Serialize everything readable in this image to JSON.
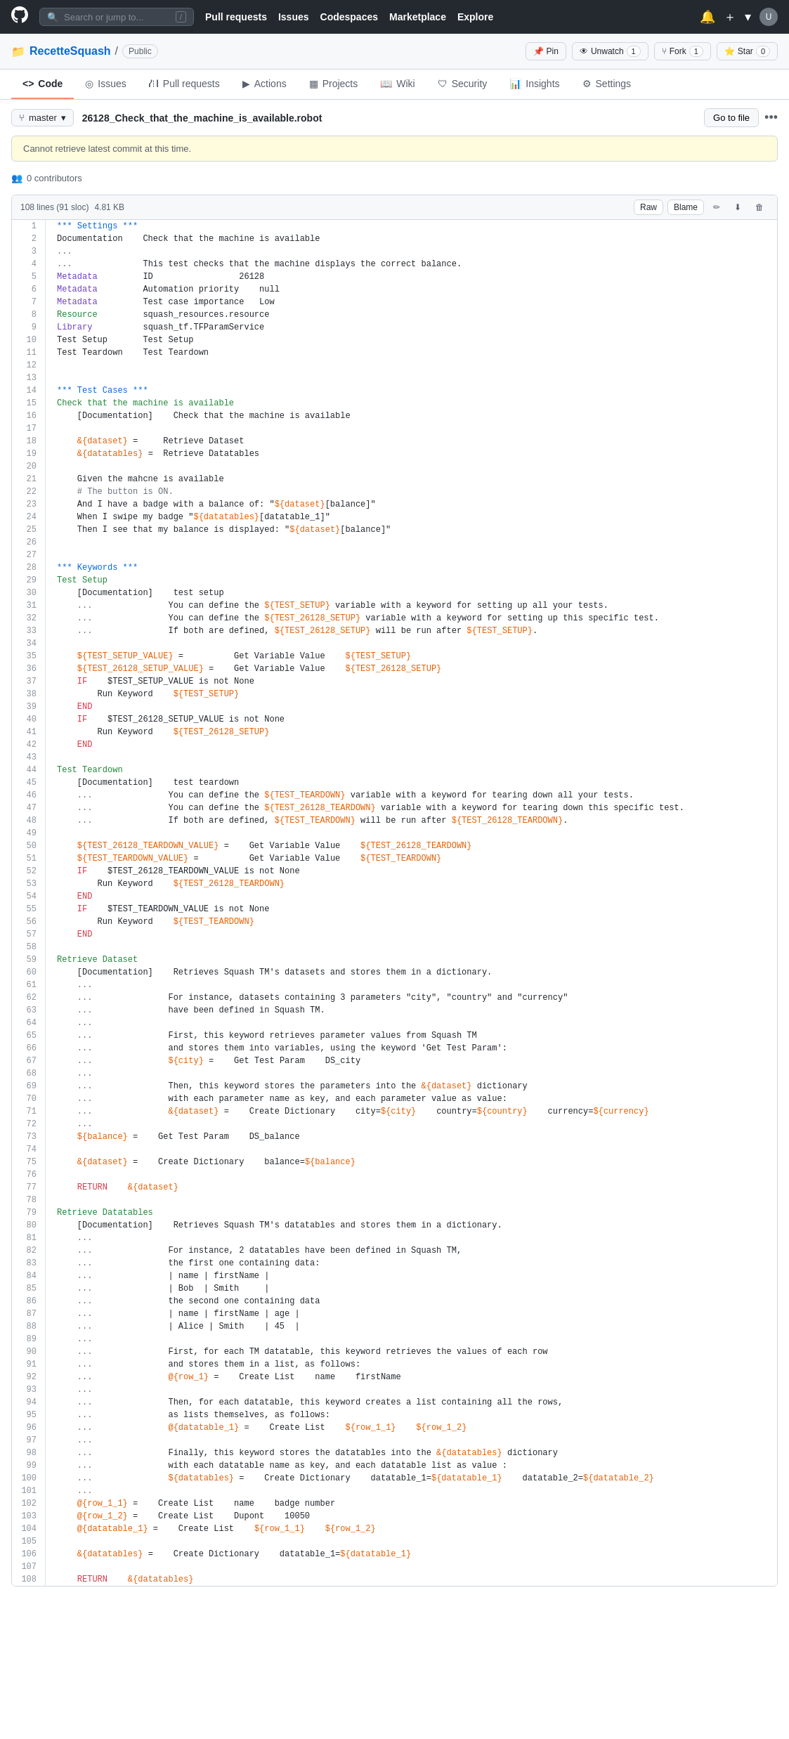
{
  "topnav": {
    "search_placeholder": "Search or jump to...",
    "slash_key": "/",
    "links": [
      "Pull requests",
      "Issues",
      "Codespaces",
      "Marketplace",
      "Explore"
    ]
  },
  "repo": {
    "owner": "RecetteSquash",
    "separator": "/",
    "visibility": "Public",
    "pin_label": "Pin",
    "unwatch_label": "Unwatch",
    "unwatch_count": "1",
    "fork_label": "Fork",
    "fork_count": "1",
    "star_label": "Star",
    "star_count": "0"
  },
  "tabs": [
    {
      "label": "Code",
      "icon": "code-icon",
      "active": true
    },
    {
      "label": "Issues",
      "icon": "issue-icon",
      "active": false
    },
    {
      "label": "Pull requests",
      "icon": "pr-icon",
      "active": false
    },
    {
      "label": "Actions",
      "icon": "action-icon",
      "active": false
    },
    {
      "label": "Projects",
      "icon": "project-icon",
      "active": false
    },
    {
      "label": "Wiki",
      "icon": "wiki-icon",
      "active": false
    },
    {
      "label": "Security",
      "icon": "security-icon",
      "active": false
    },
    {
      "label": "Insights",
      "icon": "insights-icon",
      "active": false
    },
    {
      "label": "Settings",
      "icon": "settings-icon",
      "active": false
    }
  ],
  "filenav": {
    "branch": "master",
    "file_name": "26128_Check_that_the_machine_is_available.robot",
    "go_to_file": "Go to file"
  },
  "code_info": {
    "lines": "108 lines (91 sloc)",
    "size": "4.81 KB",
    "raw_label": "Raw",
    "blame_label": "Blame"
  },
  "commit_warning": "Cannot retrieve latest commit at this time.",
  "contributors": "0 contributors",
  "code_lines": [
    {
      "n": 1,
      "t": "*** Settings ***"
    },
    {
      "n": 2,
      "t": "Documentation    Check that the machine is available"
    },
    {
      "n": 3,
      "t": "..."
    },
    {
      "n": 4,
      "t": "...              This test checks that the machine displays the correct balance."
    },
    {
      "n": 5,
      "t": "Metadata         ID                 26128"
    },
    {
      "n": 6,
      "t": "Metadata         Automation priority    null"
    },
    {
      "n": 7,
      "t": "Metadata         Test case importance   Low"
    },
    {
      "n": 8,
      "t": "Resource         squash_resources.resource"
    },
    {
      "n": 9,
      "t": "Library          squash_tf.TFParamService"
    },
    {
      "n": 10,
      "t": "Test Setup       Test Setup"
    },
    {
      "n": 11,
      "t": "Test Teardown    Test Teardown"
    },
    {
      "n": 12,
      "t": ""
    },
    {
      "n": 13,
      "t": ""
    },
    {
      "n": 14,
      "t": "*** Test Cases ***"
    },
    {
      "n": 15,
      "t": "Check that the machine is available"
    },
    {
      "n": 16,
      "t": "    [Documentation]    Check that the machine is available"
    },
    {
      "n": 17,
      "t": ""
    },
    {
      "n": 18,
      "t": "    &{dataset} =     Retrieve Dataset"
    },
    {
      "n": 19,
      "t": "    &{datatables} =  Retrieve Datatables"
    },
    {
      "n": 20,
      "t": ""
    },
    {
      "n": 21,
      "t": "    Given the mahcne is available"
    },
    {
      "n": 22,
      "t": "    # The button is ON."
    },
    {
      "n": 23,
      "t": "    And I have a badge with a balance of: \"${dataset}[balance]\""
    },
    {
      "n": 24,
      "t": "    When I swipe my badge \"${datatables}[datatable_1]\""
    },
    {
      "n": 25,
      "t": "    Then I see that my balance is displayed: \"${dataset}[balance]\""
    },
    {
      "n": 26,
      "t": ""
    },
    {
      "n": 27,
      "t": ""
    },
    {
      "n": 28,
      "t": "*** Keywords ***"
    },
    {
      "n": 29,
      "t": "Test Setup"
    },
    {
      "n": 30,
      "t": "    [Documentation]    test setup"
    },
    {
      "n": 31,
      "t": "    ...               You can define the ${TEST_SETUP} variable with a keyword for setting up all your tests."
    },
    {
      "n": 32,
      "t": "    ...               You can define the ${TEST_26128_SETUP} variable with a keyword for setting up this specific test."
    },
    {
      "n": 33,
      "t": "    ...               If both are defined, ${TEST_26128_SETUP} will be run after ${TEST_SETUP}."
    },
    {
      "n": 34,
      "t": ""
    },
    {
      "n": 35,
      "t": "    ${TEST_SETUP_VALUE} =          Get Variable Value    ${TEST_SETUP}"
    },
    {
      "n": 36,
      "t": "    ${TEST_26128_SETUP_VALUE} =    Get Variable Value    ${TEST_26128_SETUP}"
    },
    {
      "n": 37,
      "t": "    IF    $TEST_SETUP_VALUE is not None"
    },
    {
      "n": 38,
      "t": "        Run Keyword    ${TEST_SETUP}"
    },
    {
      "n": 39,
      "t": "    END"
    },
    {
      "n": 40,
      "t": "    IF    $TEST_26128_SETUP_VALUE is not None"
    },
    {
      "n": 41,
      "t": "        Run Keyword    ${TEST_26128_SETUP}"
    },
    {
      "n": 42,
      "t": "    END"
    },
    {
      "n": 43,
      "t": ""
    },
    {
      "n": 44,
      "t": "Test Teardown"
    },
    {
      "n": 45,
      "t": "    [Documentation]    test teardown"
    },
    {
      "n": 46,
      "t": "    ...               You can define the ${TEST_TEARDOWN} variable with a keyword for tearing down all your tests."
    },
    {
      "n": 47,
      "t": "    ...               You can define the ${TEST_26128_TEARDOWN} variable with a keyword for tearing down this specific test."
    },
    {
      "n": 48,
      "t": "    ...               If both are defined, ${TEST_TEARDOWN} will be run after ${TEST_26128_TEARDOWN}."
    },
    {
      "n": 49,
      "t": ""
    },
    {
      "n": 50,
      "t": "    ${TEST_26128_TEARDOWN_VALUE} =    Get Variable Value    ${TEST_26128_TEARDOWN}"
    },
    {
      "n": 51,
      "t": "    ${TEST_TEARDOWN_VALUE} =          Get Variable Value    ${TEST_TEARDOWN}"
    },
    {
      "n": 52,
      "t": "    IF    $TEST_26128_TEARDOWN_VALUE is not None"
    },
    {
      "n": 53,
      "t": "        Run Keyword    ${TEST_26128_TEARDOWN}"
    },
    {
      "n": 54,
      "t": "    END"
    },
    {
      "n": 55,
      "t": "    IF    $TEST_TEARDOWN_VALUE is not None"
    },
    {
      "n": 56,
      "t": "        Run Keyword    ${TEST_TEARDOWN}"
    },
    {
      "n": 57,
      "t": "    END"
    },
    {
      "n": 58,
      "t": ""
    },
    {
      "n": 59,
      "t": "Retrieve Dataset"
    },
    {
      "n": 60,
      "t": "    [Documentation]    Retrieves Squash TM's datasets and stores them in a dictionary."
    },
    {
      "n": 61,
      "t": "    ..."
    },
    {
      "n": 62,
      "t": "    ...               For instance, datasets containing 3 parameters \"city\", \"country\" and \"currency\""
    },
    {
      "n": 63,
      "t": "    ...               have been defined in Squash TM."
    },
    {
      "n": 64,
      "t": "    ..."
    },
    {
      "n": 65,
      "t": "    ...               First, this keyword retrieves parameter values from Squash TM"
    },
    {
      "n": 66,
      "t": "    ...               and stores them into variables, using the keyword 'Get Test Param':"
    },
    {
      "n": 67,
      "t": "    ...               ${city} =    Get Test Param    DS_city"
    },
    {
      "n": 68,
      "t": "    ..."
    },
    {
      "n": 69,
      "t": "    ...               Then, this keyword stores the parameters into the &{dataset} dictionary"
    },
    {
      "n": 70,
      "t": "    ...               with each parameter name as key, and each parameter value as value:"
    },
    {
      "n": 71,
      "t": "    ...               &{dataset} =    Create Dictionary    city=${city}    country=${country}    currency=${currency}"
    },
    {
      "n": 72,
      "t": "    ..."
    },
    {
      "n": 73,
      "t": "    ${balance} =    Get Test Param    DS_balance"
    },
    {
      "n": 74,
      "t": ""
    },
    {
      "n": 75,
      "t": "    &{dataset} =    Create Dictionary    balance=${balance}"
    },
    {
      "n": 76,
      "t": ""
    },
    {
      "n": 77,
      "t": "    RETURN    &{dataset}"
    },
    {
      "n": 78,
      "t": ""
    },
    {
      "n": 79,
      "t": "Retrieve Datatables"
    },
    {
      "n": 80,
      "t": "    [Documentation]    Retrieves Squash TM's datatables and stores them in a dictionary."
    },
    {
      "n": 81,
      "t": "    ..."
    },
    {
      "n": 82,
      "t": "    ...               For instance, 2 datatables have been defined in Squash TM,"
    },
    {
      "n": 83,
      "t": "    ...               the first one containing data:"
    },
    {
      "n": 84,
      "t": "    ...               | name | firstName |"
    },
    {
      "n": 85,
      "t": "    ...               | Bob  | Smith     |"
    },
    {
      "n": 86,
      "t": "    ...               the second one containing data"
    },
    {
      "n": 87,
      "t": "    ...               | name | firstName | age |"
    },
    {
      "n": 88,
      "t": "    ...               | Alice | Smith    | 45  |"
    },
    {
      "n": 89,
      "t": "    ..."
    },
    {
      "n": 90,
      "t": "    ...               First, for each TM datatable, this keyword retrieves the values of each row"
    },
    {
      "n": 91,
      "t": "    ...               and stores them in a list, as follows:"
    },
    {
      "n": 92,
      "t": "    ...               @{row_1} =    Create List    name    firstName"
    },
    {
      "n": 93,
      "t": "    ..."
    },
    {
      "n": 94,
      "t": "    ...               Then, for each datatable, this keyword creates a list containing all the rows,"
    },
    {
      "n": 95,
      "t": "    ...               as lists themselves, as follows:"
    },
    {
      "n": 96,
      "t": "    ...               @{datatable_1} =    Create List    ${row_1_1}    ${row_1_2}"
    },
    {
      "n": 97,
      "t": "    ..."
    },
    {
      "n": 98,
      "t": "    ...               Finally, this keyword stores the datatables into the &{datatables} dictionary"
    },
    {
      "n": 99,
      "t": "    ...               with each datatable name as key, and each datatable list as value :"
    },
    {
      "n": 100,
      "t": "    ...               ${datatables} =    Create Dictionary    datatable_1=${datatable_1}    datatable_2=${datatable_2}"
    },
    {
      "n": 101,
      "t": "    ..."
    },
    {
      "n": 102,
      "t": "    @{row_1_1} =    Create List    name    badge number"
    },
    {
      "n": 103,
      "t": "    @{row_1_2} =    Create List    Dupont    10050"
    },
    {
      "n": 104,
      "t": "    @{datatable_1} =    Create List    ${row_1_1}    ${row_1_2}"
    },
    {
      "n": 105,
      "t": ""
    },
    {
      "n": 106,
      "t": "    &{datatables} =    Create Dictionary    datatable_1=${datatable_1}"
    },
    {
      "n": 107,
      "t": ""
    },
    {
      "n": 108,
      "t": "    RETURN    &{datatables}"
    }
  ]
}
